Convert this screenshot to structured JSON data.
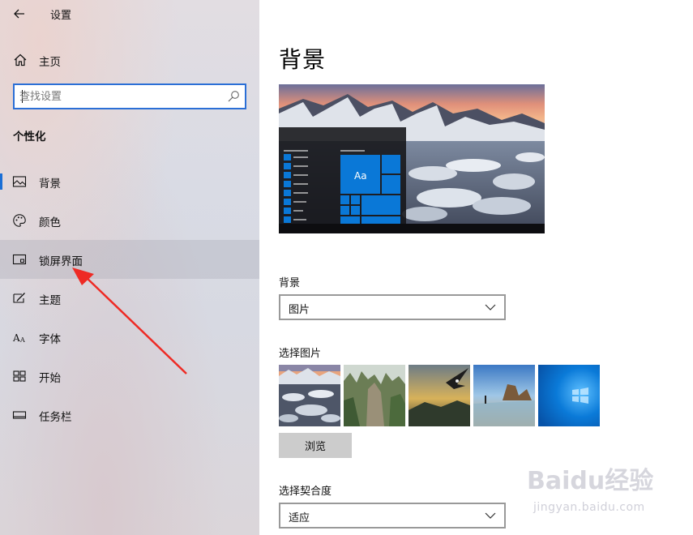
{
  "window": {
    "title": "设置"
  },
  "sidebar": {
    "home_label": "主页",
    "search_placeholder": "查找设置",
    "section_title": "个性化",
    "items": [
      {
        "label": "背景",
        "icon": "picture-icon",
        "selected": true
      },
      {
        "label": "颜色",
        "icon": "palette-icon",
        "selected": false
      },
      {
        "label": "锁屏界面",
        "icon": "lock-screen-icon",
        "selected": false,
        "hovered": true
      },
      {
        "label": "主题",
        "icon": "theme-icon",
        "selected": false
      },
      {
        "label": "字体",
        "icon": "font-icon",
        "selected": false
      },
      {
        "label": "开始",
        "icon": "start-icon",
        "selected": false
      },
      {
        "label": "任务栏",
        "icon": "taskbar-icon",
        "selected": false
      }
    ]
  },
  "main": {
    "page_title": "背景",
    "preview": {
      "tile_text": "Aa"
    },
    "background_label": "背景",
    "background_value": "图片",
    "choose_picture_label": "选择图片",
    "browse_label": "浏览",
    "fit_label": "选择契合度",
    "fit_value": "适应"
  },
  "watermark": {
    "logo": "Baidu经验",
    "url": "jingyan.baidu.com"
  },
  "colors": {
    "accent": "#1a6fd6",
    "tile": "#0a78d7",
    "annotation_arrow": "#ee2a24"
  }
}
